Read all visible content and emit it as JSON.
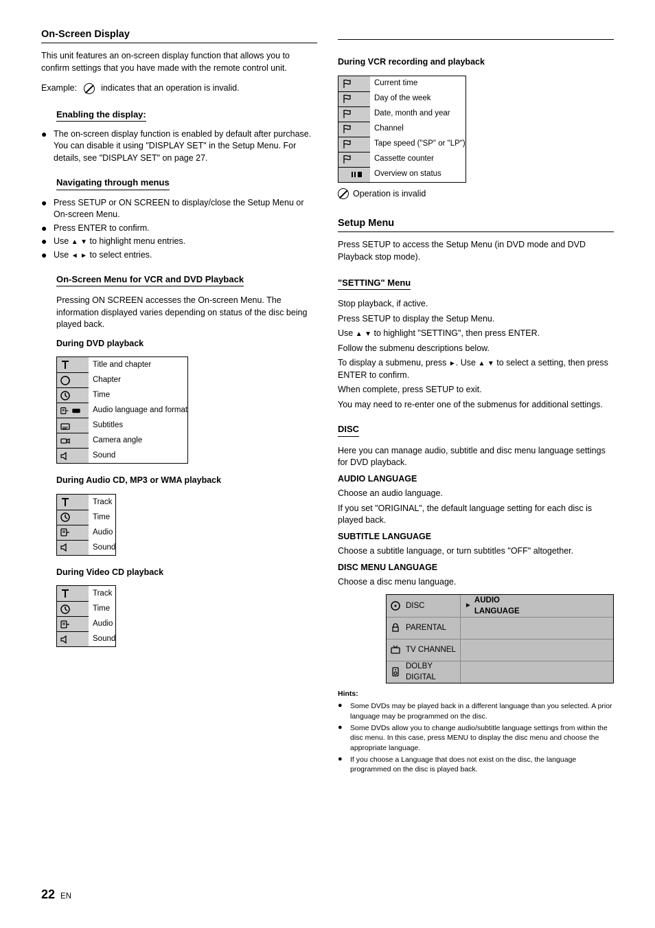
{
  "left": {
    "title": "On-Screen Display",
    "intro1": "This unit features an on-screen display function that allows you to confirm settings that you have made with the remote control unit.",
    "intro_example": "Example:",
    "intro_invalid": "indicates that an operation is invalid.",
    "sub1_title": "Enabling the display:",
    "sub1_body": "The on-screen display function is enabled by default after purchase. You can disable it using \"DISPLAY SET\" in the Setup Menu. For details, see \"DISPLAY SET\" on page 27.",
    "sub2_title": "Navigating through menus",
    "sub2_items": [
      "Press SETUP or ON SCREEN to display/close the Setup Menu or On-screen Menu.",
      "Press ENTER to confirm.",
      "Use       to highlight menu entries.",
      "Use       to select entries."
    ],
    "sub3_title": "On-Screen Menu for VCR and DVD Playback",
    "sub3_intro1": "Pressing ON SCREEN accesses the On-screen Menu. The information displayed varies depending on status of the disc being played back.",
    "sub3_intro2": "During DVD playback",
    "dvd_list": [
      {
        "icon": "title",
        "label": "Title and chapter"
      },
      {
        "icon": "chapter",
        "label": "Chapter"
      },
      {
        "icon": "clock",
        "label": "Time"
      },
      {
        "icon": "lang",
        "label": "Audio language and format"
      },
      {
        "icon": "subtitle",
        "label": "Subtitles"
      },
      {
        "icon": "angle",
        "label": "Camera angle"
      },
      {
        "icon": "sound",
        "label": "Sound"
      }
    ],
    "sub3_intro3": "During Audio CD, MP3 or WMA playback",
    "cd_list": [
      {
        "icon": "title",
        "label": "Track"
      },
      {
        "icon": "clock",
        "label": "Time"
      },
      {
        "icon": "lang",
        "label": "Audio"
      },
      {
        "icon": "sound",
        "label": "Sound"
      }
    ],
    "sub3_intro4": "During Video CD playback",
    "vcd_list": [
      {
        "icon": "title",
        "label": "Track"
      },
      {
        "icon": "clock",
        "label": "Time"
      },
      {
        "icon": "lang",
        "label": "Audio"
      },
      {
        "icon": "sound",
        "label": "Sound"
      }
    ]
  },
  "right": {
    "intro": "During VCR recording and playback",
    "vcr_list": [
      {
        "icon": "flag",
        "label": "Current time"
      },
      {
        "icon": "flag",
        "label": "Day of the week"
      },
      {
        "icon": "flag",
        "label": "Date, month and year"
      },
      {
        "icon": "flag",
        "label": "Channel"
      },
      {
        "icon": "flag",
        "label": "Tape speed (\"SP\" or \"LP\")"
      },
      {
        "icon": "flag",
        "label": "Cassette counter"
      },
      {
        "icon": "pause",
        "label": "Overview on status"
      },
      {
        "icon": "prohibit",
        "label": "Operation is invalid"
      }
    ],
    "setup_title": "Setup Menu",
    "setup_body": "Press SETUP to access the Setup Menu (in DVD mode and DVD Playback stop mode).",
    "setup_sub": "\"SETTING\" Menu",
    "setup_steps": [
      "Stop playback, if active.",
      "Press SETUP to display the Setup Menu.",
      "Use       to highlight \"SETTING\", then press ENTER.",
      "Follow the submenu descriptions below.",
      "To display a submenu, press     . Use        to select a setting, then press ENTER to confirm.",
      "When complete, press SETUP to exit.",
      "You may need to re-enter one of the submenus for additional settings."
    ],
    "disc_title": "DISC",
    "disc_intro": "Here you can manage audio, subtitle and disc menu language settings for DVD playback.",
    "disc_audio_h": "AUDIO LANGUAGE",
    "disc_audio_b1": "Choose an audio language.",
    "disc_audio_b2": "If you set \"ORIGINAL\", the default language setting for each disc is played back.",
    "disc_sub_h": "SUBTITLE LANGUAGE",
    "disc_sub_b": "Choose a subtitle language, or turn subtitles \"OFF\" altogether.",
    "disc_menu_h": "DISC MENU LANGUAGE",
    "disc_menu_b": "Choose a disc menu language.",
    "menu": [
      {
        "icon": "disc",
        "label": "DISC",
        "value": "AUDIO LANGUAGE"
      },
      {
        "icon": "lock",
        "label": "PARENTAL",
        "value": ""
      },
      {
        "icon": "tv",
        "label": "TV CHANNEL",
        "value": ""
      },
      {
        "icon": "spk",
        "label": "DOLBY DIGITAL",
        "value": ""
      }
    ],
    "hints_h": "Hints:",
    "hints": [
      "Some DVDs may be played back in a different language than you selected. A prior language may be programmed on the disc.",
      "Some DVDs allow you to change audio/subtitle language settings from within the disc menu. In this case, press MENU to display the disc menu and choose the appropriate language.",
      "If you choose a Language that does not exist on the disc, the language programmed on the disc is played back."
    ]
  },
  "pagenum": {
    "n": "22",
    "t": "EN"
  }
}
